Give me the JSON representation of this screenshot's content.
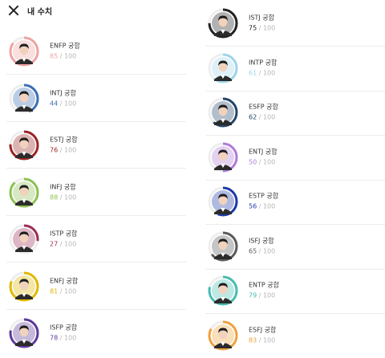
{
  "header": {
    "title": "내 수치"
  },
  "left": [
    {
      "label": "ENFP 궁합",
      "value": "85",
      "max": "100",
      "color": "#f0a3a3",
      "level": 0.85
    },
    {
      "label": "INTJ 궁합",
      "value": "44",
      "max": "100",
      "color": "#3b6fb6",
      "level": 0.44
    },
    {
      "label": "ESTJ 궁합",
      "value": "76",
      "max": "100",
      "color": "#9b2424",
      "level": 0.76
    },
    {
      "label": "INFJ 궁합",
      "value": "88",
      "max": "100",
      "color": "#8cc152",
      "level": 0.88
    },
    {
      "label": "ISTP 궁합",
      "value": "27",
      "max": "100",
      "color": "#9b2d56",
      "level": 0.27
    },
    {
      "label": "ENFJ 궁합",
      "value": "81",
      "max": "100",
      "color": "#e0b800",
      "level": 0.81
    },
    {
      "label": "ISFP 궁합",
      "value": "78",
      "max": "100",
      "color": "#5c3a99",
      "level": 0.78
    }
  ],
  "right": [
    {
      "label": "ISTJ 궁합",
      "value": "75",
      "max": "100",
      "color": "#222222",
      "level": 0.75
    },
    {
      "label": "INTP 궁합",
      "value": "61",
      "max": "100",
      "color": "#9fd4ea",
      "level": 0.61
    },
    {
      "label": "ESFP 궁합",
      "value": "62",
      "max": "100",
      "color": "#23456b",
      "level": 0.62
    },
    {
      "label": "ENTJ 궁합",
      "value": "50",
      "max": "100",
      "color": "#b07ad6",
      "level": 0.5
    },
    {
      "label": "ESTP 궁합",
      "value": "56",
      "max": "100",
      "color": "#1c3aa6",
      "level": 0.56
    },
    {
      "label": "ISFJ 궁합",
      "value": "65",
      "max": "100",
      "color": "#5a5a5a",
      "level": 0.65
    },
    {
      "label": "ENTP 궁합",
      "value": "79",
      "max": "100",
      "color": "#45bcb2",
      "level": 0.79
    },
    {
      "label": "ESFJ 궁합",
      "value": "83",
      "max": "100",
      "color": "#f0a23b",
      "level": 0.83
    }
  ]
}
